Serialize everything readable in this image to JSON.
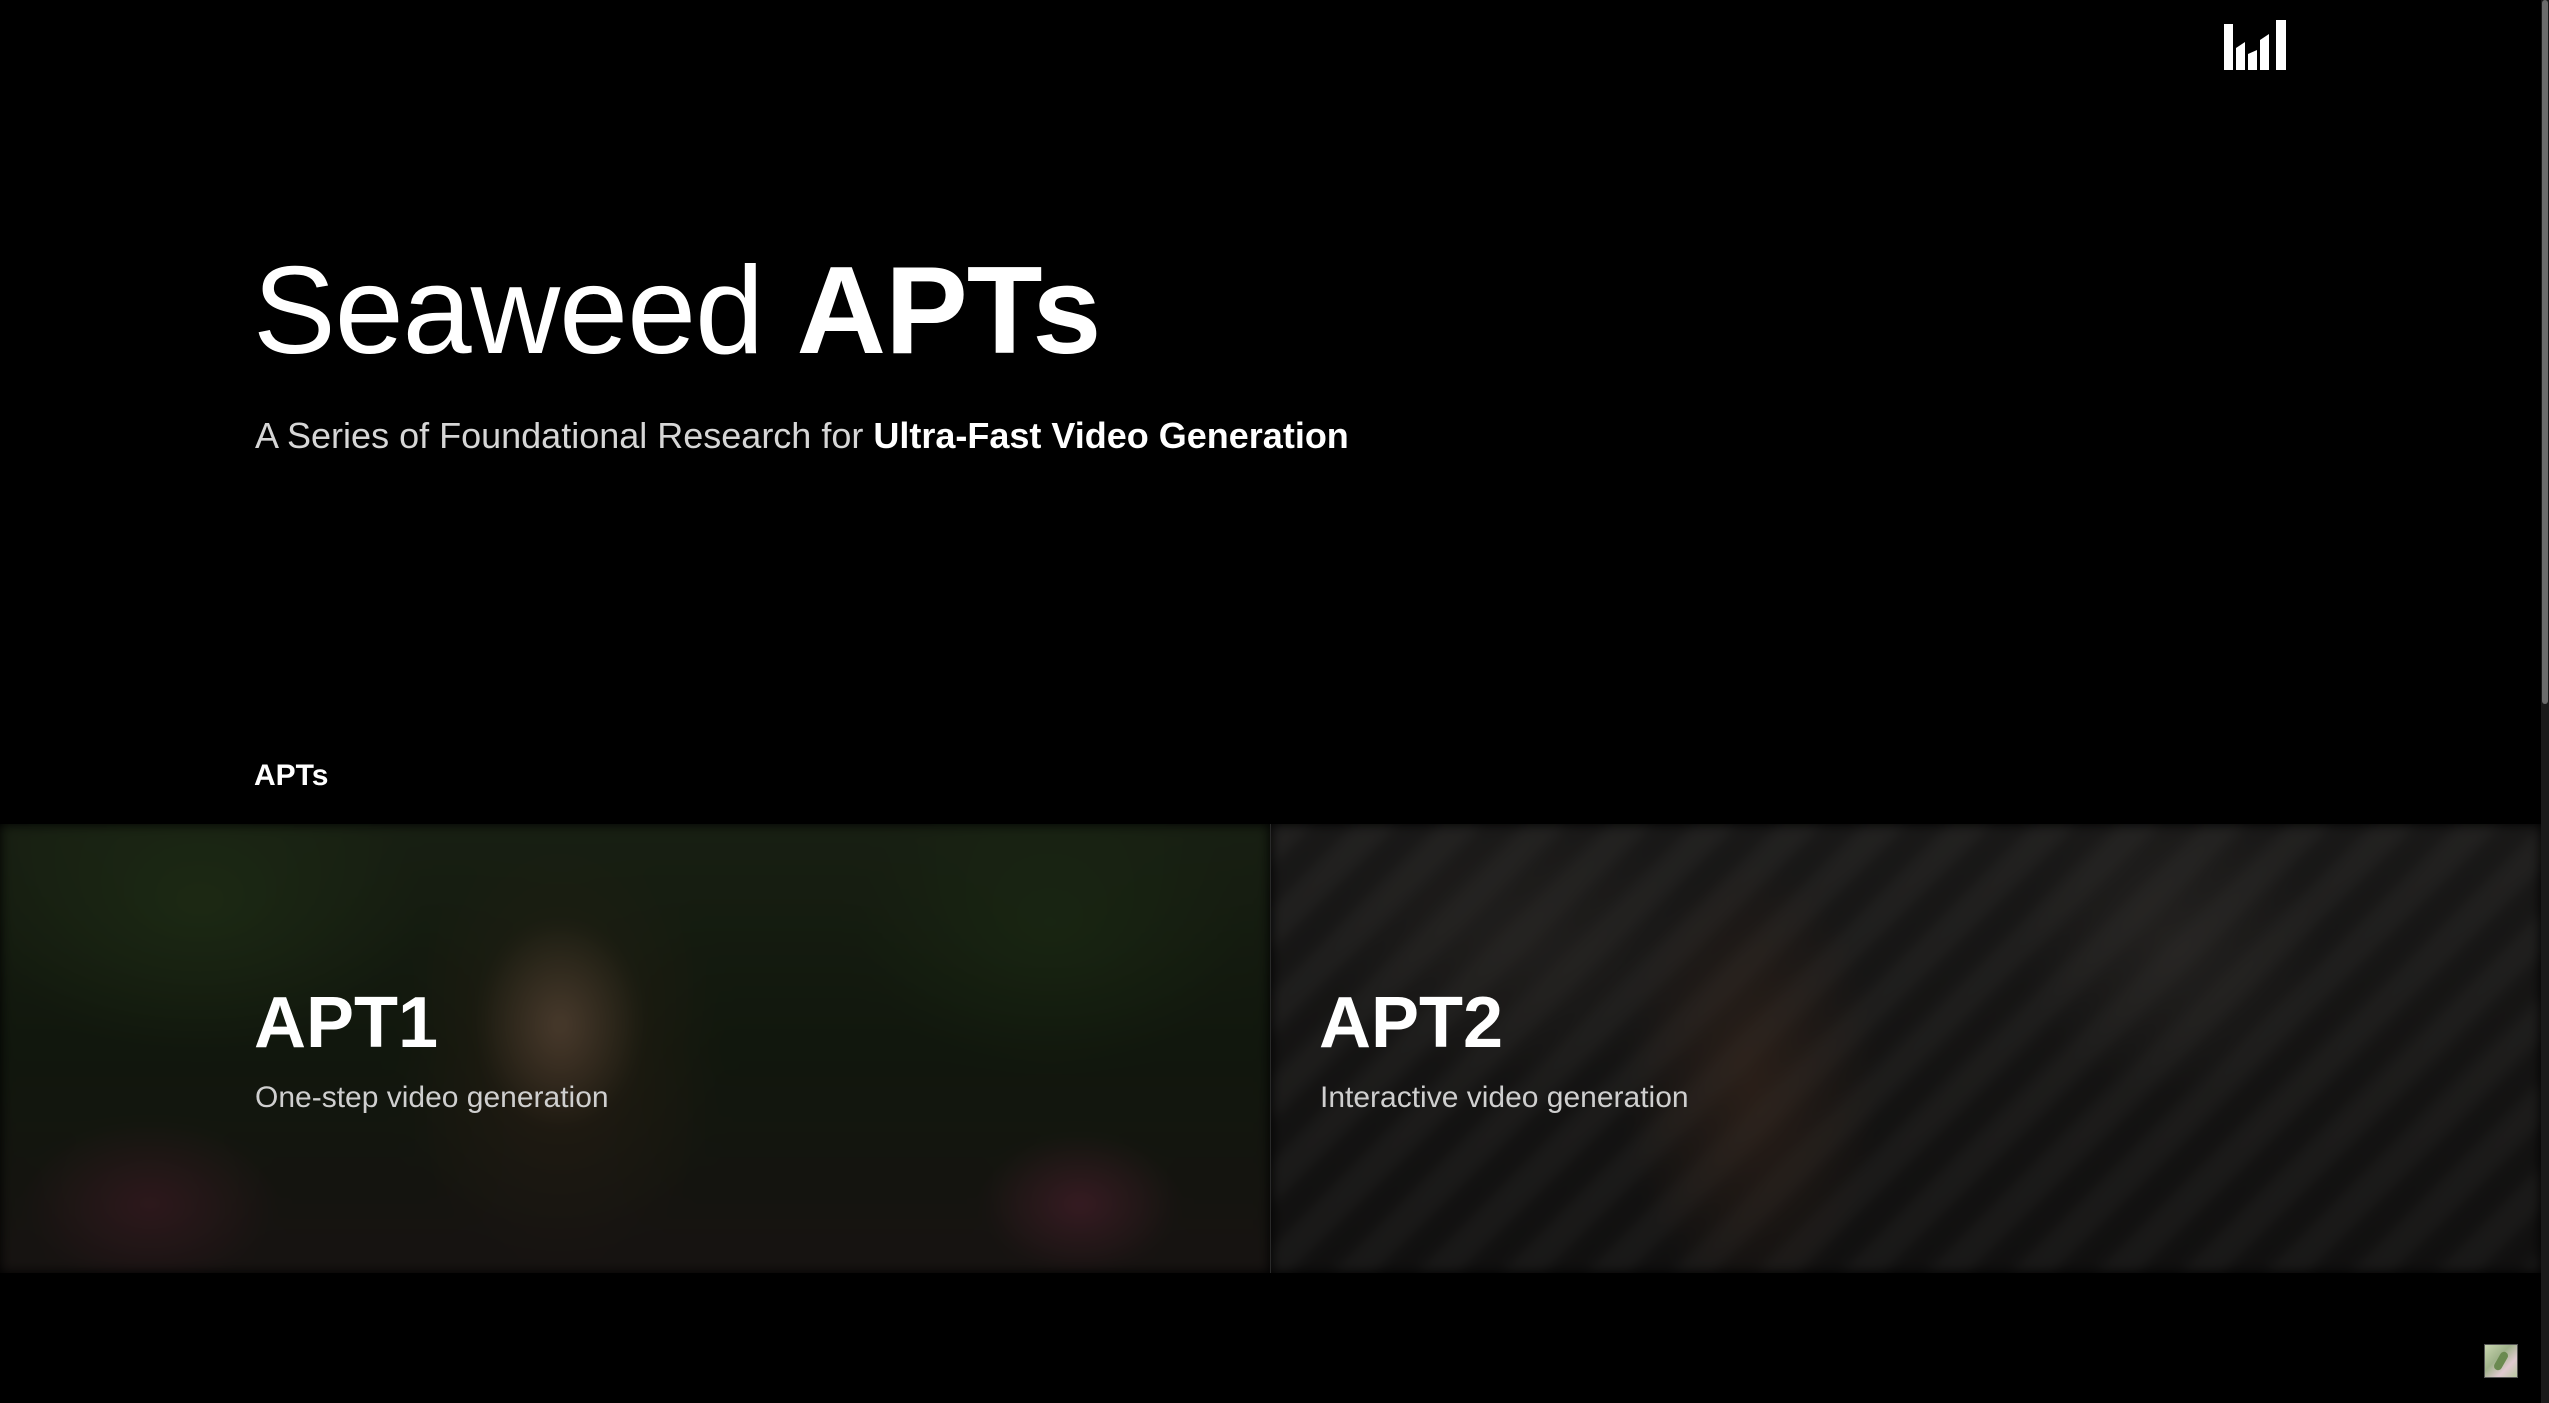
{
  "header": {
    "logo_icon": "bar-chart-logo-icon"
  },
  "hero": {
    "title_light": "Seaweed",
    "title_bold": "APTs",
    "subtitle_prefix": "A Series of Foundational Research for",
    "subtitle_bold": "Ultra-Fast Video Generation"
  },
  "section": {
    "label": "APTs"
  },
  "cards": [
    {
      "title": "APT1",
      "description": "One-step video generation"
    },
    {
      "title": "APT2",
      "description": "Interactive video generation"
    }
  ],
  "colors": {
    "background": "#000000",
    "text_primary": "#ffffff",
    "text_secondary": "#d6d6d6"
  },
  "widget": {
    "icon": "image-thumbnail-icon"
  }
}
